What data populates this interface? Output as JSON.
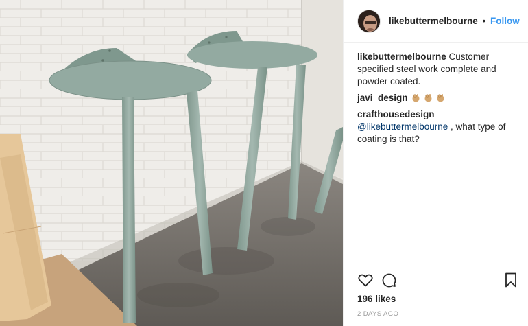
{
  "post": {
    "image_alt": "Two powder coated steel wall tables with half-moon tops and angled legs",
    "colors": {
      "table": "#8fa79d",
      "wall": "#efede8",
      "floor": "#6b6762"
    }
  },
  "header": {
    "username": "likebuttermelbourne",
    "separator": "•",
    "follow_label": "Follow"
  },
  "comments": [
    {
      "author": "likebuttermelbourne",
      "text": "Customer specified steel work complete and powder coated."
    },
    {
      "author": "javi_design",
      "text": "",
      "emoji": [
        "ok-hand-emoji",
        "ok-hand-emoji",
        "ok-hand-emoji"
      ]
    },
    {
      "author": "crafthousedesign",
      "mention": "@likebuttermelbourne",
      "text": " , what type of coating is that?"
    }
  ],
  "footer": {
    "icons": [
      "heart-icon",
      "comment-icon",
      "bookmark-icon"
    ],
    "likes": "196 likes",
    "timestamp": "2 DAYS AGO"
  },
  "theme": {
    "link_blue": "#3897f0",
    "mention_blue": "#003569",
    "text": "#262626",
    "muted": "#999999",
    "divider": "#efefef"
  }
}
